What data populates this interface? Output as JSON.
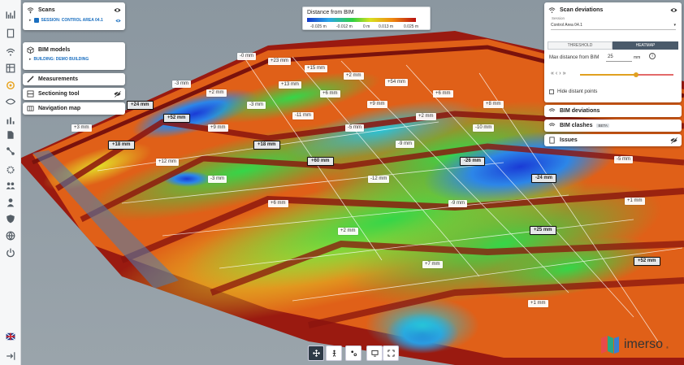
{
  "left_rail": {
    "icons": [
      "chart-icon",
      "document-icon",
      "signal-icon",
      "table-icon",
      "layers-icon",
      "eye-icon",
      "bar-chart-icon",
      "file-icon",
      "flow-icon",
      "settings-icon",
      "users-icon",
      "person-icon",
      "shield-icon",
      "globe-icon",
      "power-icon",
      "language-flag-icon",
      "logout-icon"
    ]
  },
  "scans": {
    "title": "Scans",
    "session_label": "SESSION: CONTROL AREA 04.1"
  },
  "bim_models": {
    "title": "BIM models",
    "building_label": "BUILDING: DEMO BUILDING"
  },
  "measurements": {
    "title": "Measurements"
  },
  "sectioning": {
    "title": "Sectioning tool"
  },
  "navigation": {
    "title": "Navigation map"
  },
  "legend": {
    "title": "Distance from BIM",
    "ticks": [
      "-0.025 m",
      "-0.012 m",
      "0 m",
      "0.013 m",
      "0.025 m"
    ],
    "colors": {
      "low": "#1338c8",
      "mid": "#30d040",
      "high": "#b81010"
    }
  },
  "scan_deviations": {
    "title": "Scan deviations",
    "session_label": "Session",
    "session_value": "Control Area 04.1",
    "tab_threshold": "THRESHOLD",
    "tab_heatmap": "HEATMAP",
    "max_distance_label": "Max distance from BIM",
    "max_distance_value": "25",
    "unit": "mm",
    "slider_value": 0.6,
    "hide_distant_label": "Hide distant points"
  },
  "bim_deviations": {
    "title": "BIM deviations"
  },
  "bim_clashes": {
    "title": "BIM clashes",
    "badge": "BETA"
  },
  "issues": {
    "title": "Issues"
  },
  "labels": [
    {
      "t": "-0 mm",
      "dark": false
    },
    {
      "t": "+23 mm",
      "dark": false
    },
    {
      "t": "+15 mm",
      "dark": false
    },
    {
      "t": "+2 mm",
      "dark": false
    },
    {
      "t": "+54 mm",
      "dark": false
    },
    {
      "t": "-3 mm",
      "dark": false
    },
    {
      "t": "+13 mm",
      "dark": false
    },
    {
      "t": "+2 mm",
      "dark": false
    },
    {
      "t": "+6 mm",
      "dark": false
    },
    {
      "t": "+6 mm",
      "dark": false
    },
    {
      "t": "+24 mm",
      "dark": true
    },
    {
      "t": "-3 mm",
      "dark": false
    },
    {
      "t": "+9 mm",
      "dark": false
    },
    {
      "t": "+8 mm",
      "dark": false
    },
    {
      "t": "+52 mm",
      "dark": true
    },
    {
      "t": "-11 mm",
      "dark": false
    },
    {
      "t": "+2 mm",
      "dark": false
    },
    {
      "t": "+3 mm",
      "dark": false
    },
    {
      "t": "+9 mm",
      "dark": false
    },
    {
      "t": "-5 mm",
      "dark": false
    },
    {
      "t": "-10 mm",
      "dark": false
    },
    {
      "t": "+18 mm",
      "dark": true
    },
    {
      "t": "+18 mm",
      "dark": true
    },
    {
      "t": "-9 mm",
      "dark": false
    },
    {
      "t": "+12 mm",
      "dark": false
    },
    {
      "t": "+60 mm",
      "dark": true
    },
    {
      "t": "-26 mm",
      "dark": true
    },
    {
      "t": "-5 mm",
      "dark": false
    },
    {
      "t": "-3 mm",
      "dark": false
    },
    {
      "t": "-12 mm",
      "dark": false
    },
    {
      "t": "-24 mm",
      "dark": true
    },
    {
      "t": "+6 mm",
      "dark": false
    },
    {
      "t": "-9 mm",
      "dark": false
    },
    {
      "t": "+1 mm",
      "dark": false
    },
    {
      "t": "+2 mm",
      "dark": false
    },
    {
      "t": "+25 mm",
      "dark": true
    },
    {
      "t": "+7 mm",
      "dark": false
    },
    {
      "t": "+52 mm",
      "dark": true
    },
    {
      "t": "+1 mm",
      "dark": false
    }
  ],
  "toolbar": {
    "icons": [
      "move-icon",
      "walk-icon",
      "orbit-icon",
      "screen-icon",
      "fullscreen-icon"
    ]
  },
  "brand": {
    "name": "imerso",
    "mark": "®"
  }
}
